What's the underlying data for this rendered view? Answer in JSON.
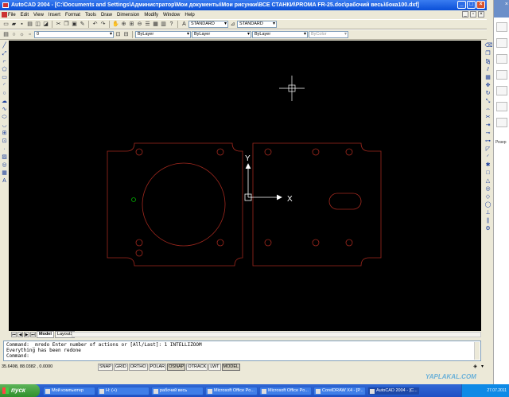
{
  "window": {
    "title": "AutoCAD 2004 - [C:\\Documents and Settings\\Администратор\\Мои документы\\Мои рисунки\\ВСЕ СТАНКИ\\PROMA FR-25.doc\\рабочий весь\\бока100.dxf]",
    "min": "_",
    "max": "□",
    "close": "×"
  },
  "menu": [
    "File",
    "Edit",
    "View",
    "Insert",
    "Format",
    "Tools",
    "Draw",
    "Dimension",
    "Modify",
    "Window",
    "Help"
  ],
  "toolbar1": {
    "text_style": "STANDARD",
    "dim_style": "STANDARD"
  },
  "toolbar2": {
    "layer": "0",
    "color": "ByLayer",
    "linetype": "ByLayer",
    "lineweight": "ByLayer",
    "plotstyle": "ByColor"
  },
  "canvas": {
    "ucs_y": "Y",
    "ucs_x": "X",
    "line_color": "#a0281e",
    "marker_color": "#00b400"
  },
  "tabs": [
    "Model",
    "Layout1"
  ],
  "command": {
    "line1": "Command: _mredo Enter number of actions or [All/Last]: 1 INTELLIZOOM",
    "line2": "Everything has been redone",
    "line3": "Command:"
  },
  "status": {
    "coords": "35.6498, 88.0382 , 0.0000",
    "buttons": [
      "SNAP",
      "GRID",
      "ORTHO",
      "POLAR",
      "OSNAP",
      "OTRACK",
      "LWT",
      "MODEL"
    ]
  },
  "right_panel": {
    "label": "Резер"
  },
  "taskbar": {
    "start": "пуск",
    "tasks": [
      "Мой компьютер",
      "H: (+)",
      "рабочий весь",
      "Microsoft Office Po...",
      "Microsoft Office Po...",
      "CorelDRAW X4 - [Р...",
      "AutoCAD 2004 - [C..."
    ],
    "date": "27.07.2011"
  },
  "watermark": "YAPLAKAL.COM"
}
